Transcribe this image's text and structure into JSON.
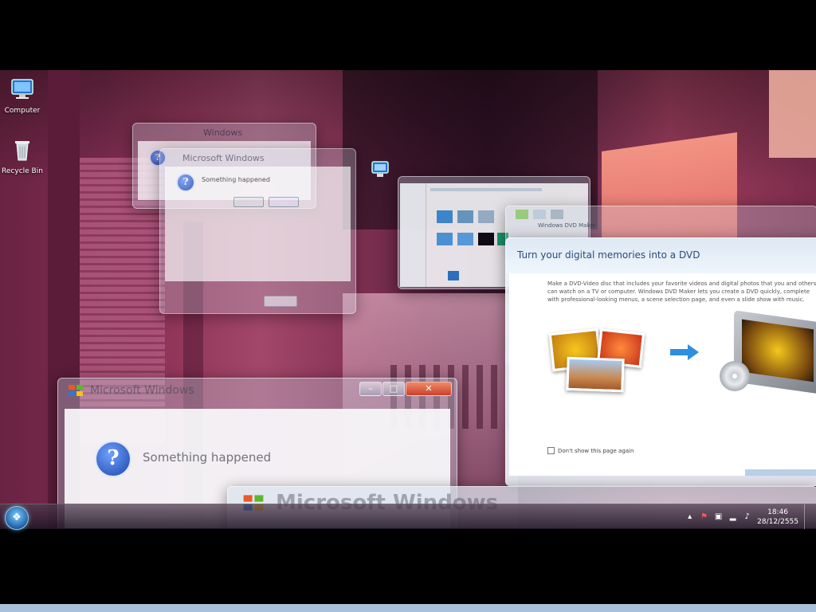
{
  "desktop": {
    "icons": [
      {
        "label": "Computer"
      },
      {
        "label": "Recycle Bin"
      }
    ]
  },
  "windows": {
    "dialog_small_back": {
      "title": "Windows"
    },
    "dialog_small_front": {
      "title": "Microsoft Windows",
      "message": "Something happened"
    },
    "dialog_large": {
      "title": "Microsoft Windows",
      "message": "Something happened",
      "close_glyph": "✕"
    },
    "dialog_bottom": {
      "title": "Microsoft Windows"
    },
    "dvd_maker": {
      "heading": "Turn your digital memories into a DVD",
      "body": "Make a DVD-Video disc that includes your favorite videos and digital photos that you and others can watch on a TV or computer. Windows DVD Maker lets you create a DVD quickly, complete with professional-looking menus, a scene selection page, and even a slide show with music.",
      "checkbox_label": "Don't show this page again"
    },
    "explorer_window_title": "Windows DVD Maker"
  },
  "taskbar": {
    "time": "18:46",
    "date": "28/12/2555"
  },
  "colors": {
    "accent": "#1f5fa8",
    "close_button": "#c9412a"
  }
}
